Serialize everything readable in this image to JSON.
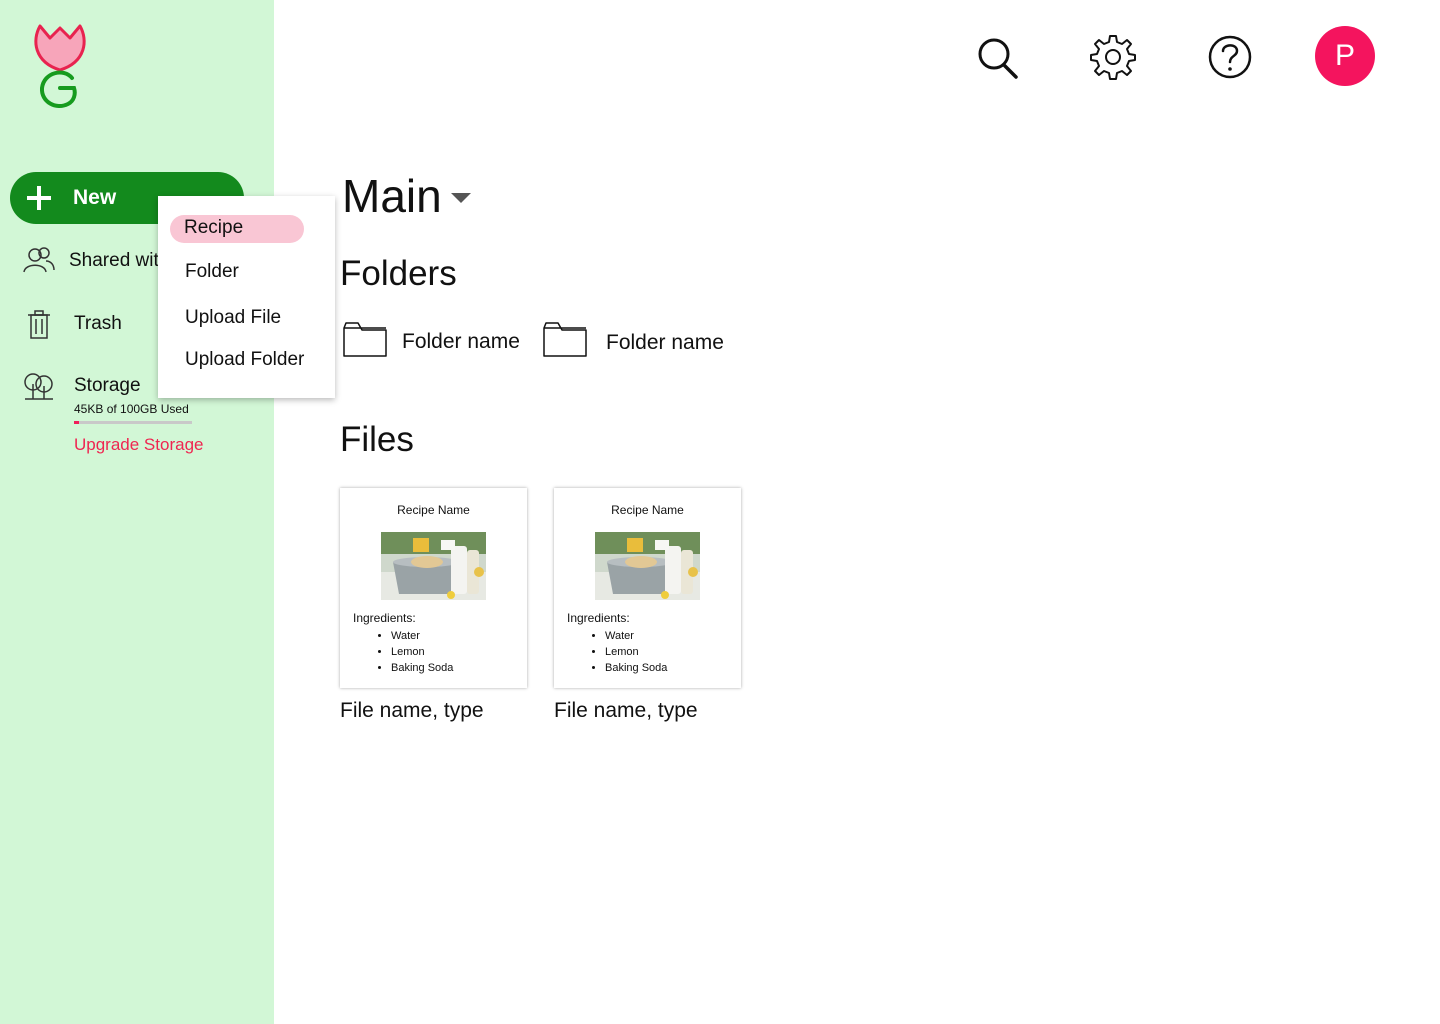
{
  "sidebar": {
    "new_label": "New",
    "items": [
      {
        "label": "Shared wit",
        "icon": "people-icon"
      },
      {
        "label": "Trash",
        "icon": "trash-icon"
      },
      {
        "label": "Storage",
        "icon": "trees-icon"
      }
    ],
    "storage": {
      "usage_text": "45KB of 100GB Used",
      "used_fraction": 0.04,
      "upgrade_label": "Upgrade Storage"
    }
  },
  "new_menu": {
    "items": [
      "Recipe",
      "Folder",
      "Upload File",
      "Upload Folder"
    ],
    "active_index": 0
  },
  "header": {
    "icons": [
      "search-icon",
      "gear-icon",
      "help-icon"
    ],
    "avatar_initial": "P"
  },
  "main": {
    "title": "Main",
    "folders_heading": "Folders",
    "folders": [
      {
        "name": "Folder name"
      },
      {
        "name": "Folder name"
      }
    ],
    "files_heading": "Files",
    "files": [
      {
        "recipe_name": "Recipe Name",
        "ingredients_label": "Ingredients:",
        "ingredients": [
          "Water",
          "Lemon",
          "Baking Soda"
        ],
        "label": "File name, type"
      },
      {
        "recipe_name": "Recipe Name",
        "ingredients_label": "Ingredients:",
        "ingredients": [
          "Water",
          "Lemon",
          "Baking Soda"
        ],
        "label": "File name, type"
      }
    ]
  },
  "colors": {
    "sidebar_bg": "#d2f7d6",
    "new_button": "#138a1d",
    "accent_pink": "#f4145e",
    "menu_active": "#f9c6d4"
  }
}
